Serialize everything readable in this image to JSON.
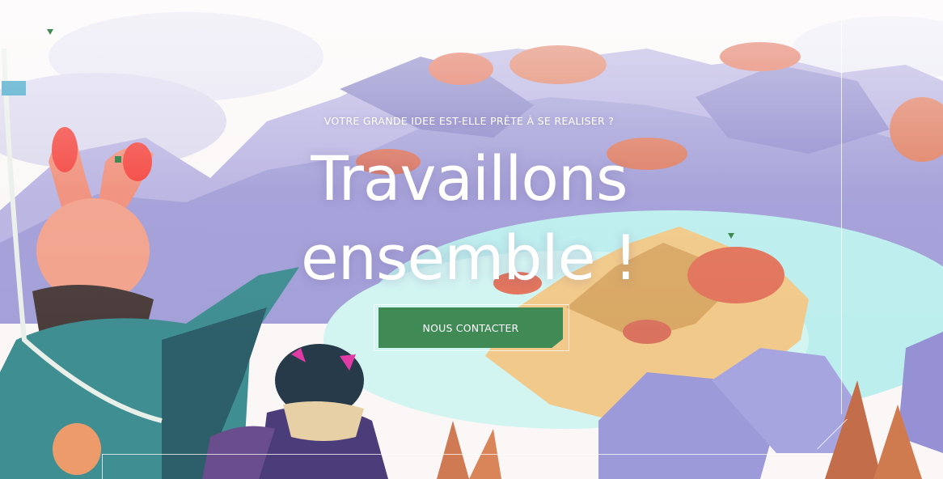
{
  "hero": {
    "eyebrow": "VOTRE GRANDE IDEE EST-ELLE PRÊTE À SE REALISER ?",
    "headline_line1": "Travaillons",
    "headline_line2": "ensemble !",
    "cta_label": "NOUS CONTACTER"
  },
  "colors": {
    "accent": "#3f8a55",
    "text": "#ffffff",
    "sky": "#fbf7f7",
    "mountains": "#9f9bd6",
    "sea": "#b8ecec",
    "sand": "#f1c98a",
    "foliage": "#e2745c"
  },
  "icons": [
    "triangle-marker-icon",
    "square-marker-icon"
  ]
}
